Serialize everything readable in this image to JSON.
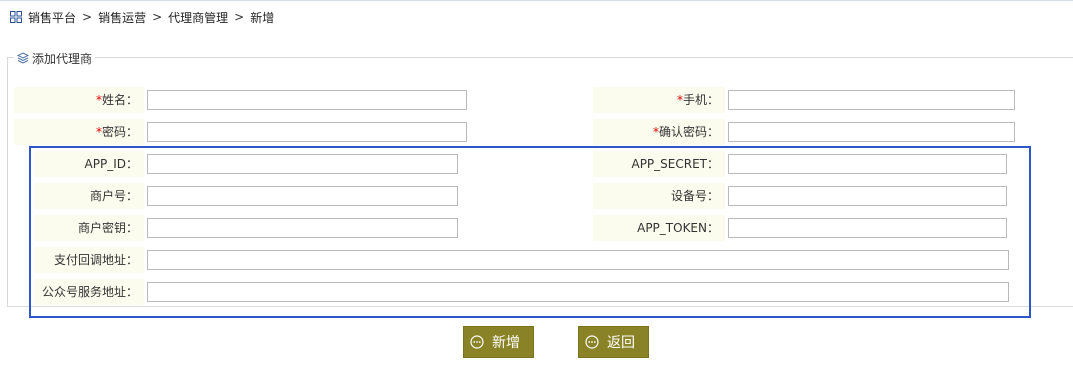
{
  "breadcrumb": {
    "icon": "grid-icon",
    "items": [
      "销售平台",
      "销售运营",
      "代理商管理",
      "新增"
    ],
    "separator": ">"
  },
  "section": {
    "icon": "layers-icon",
    "title": "添加代理商"
  },
  "form": {
    "name": {
      "required_mark": "*",
      "label": "姓名：",
      "value": ""
    },
    "phone": {
      "required_mark": "*",
      "label": "手机：",
      "value": ""
    },
    "password": {
      "required_mark": "*",
      "label": "密码：",
      "value": ""
    },
    "confirm_password": {
      "required_mark": "*",
      "label": "确认密码：",
      "value": ""
    },
    "app_id": {
      "label": "APP_ID：",
      "value": ""
    },
    "app_secret": {
      "label": "APP_SECRET：",
      "value": ""
    },
    "merchant_no": {
      "label": "商户号：",
      "value": ""
    },
    "device_no": {
      "label": "设备号：",
      "value": ""
    },
    "merchant_key": {
      "label": "商户密钥：",
      "value": ""
    },
    "app_token": {
      "label": "APP_TOKEN：",
      "value": ""
    },
    "pay_callback_url": {
      "label": "支付回调地址：",
      "value": ""
    },
    "mp_service_url": {
      "label": "公众号服务地址：",
      "value": ""
    }
  },
  "buttons": {
    "add": {
      "icon": "more-circle-icon",
      "label": "新增"
    },
    "back": {
      "icon": "more-circle-icon",
      "label": "返回"
    }
  },
  "colors": {
    "label_bg": "#fbfbee",
    "button_bg": "#8a8226",
    "highlight_border": "#2d56c8",
    "required": "#dd0000"
  }
}
